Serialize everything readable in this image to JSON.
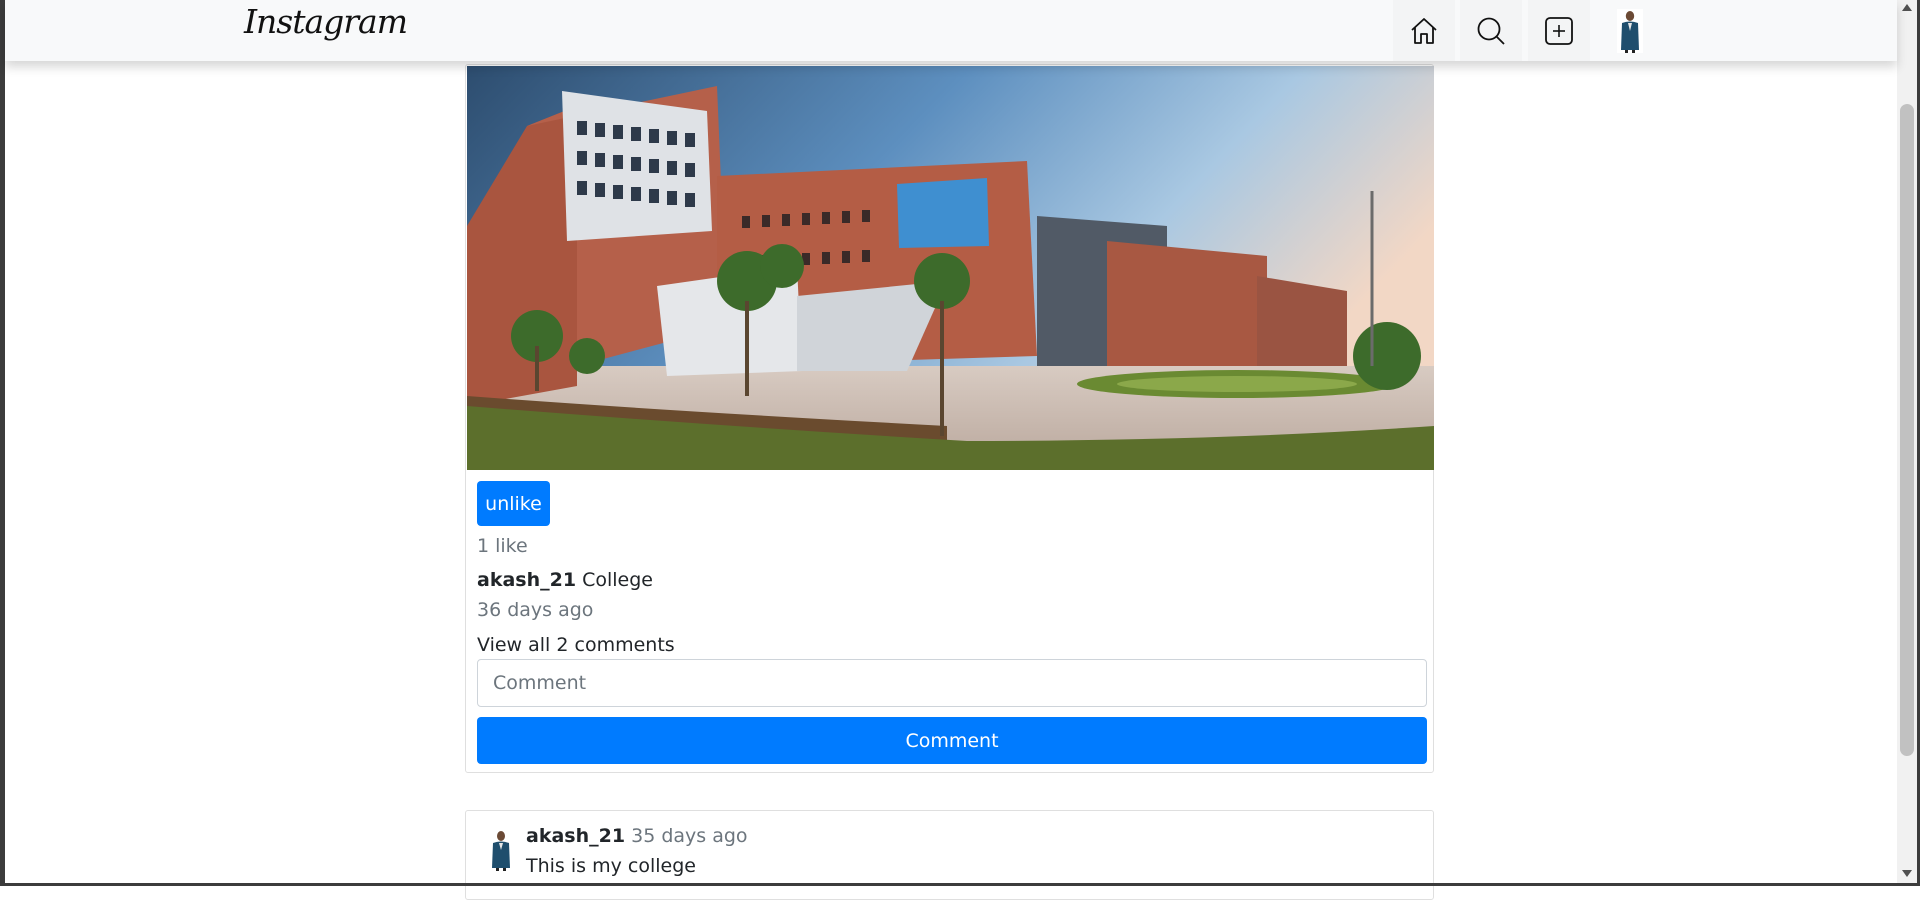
{
  "navbar": {
    "brand": "Instagram",
    "icons": [
      "home-icon",
      "search-icon",
      "add-post-icon",
      "profile-avatar"
    ]
  },
  "post": {
    "image_alt": "College campus panorama",
    "unlike_label": "unlike",
    "likes_text": "1 like",
    "username": "akash_21",
    "caption": "College",
    "time_ago": "36 days ago",
    "view_comments": "View all 2 comments",
    "comment_placeholder": "Comment",
    "comment_button": "Comment"
  },
  "comments": [
    {
      "username": "akash_21",
      "time_ago": "35 days ago",
      "text": "This is my college"
    }
  ],
  "colors": {
    "primary": "#007bff",
    "muted": "#6c757d",
    "navbar_bg": "#f8f9fa"
  }
}
